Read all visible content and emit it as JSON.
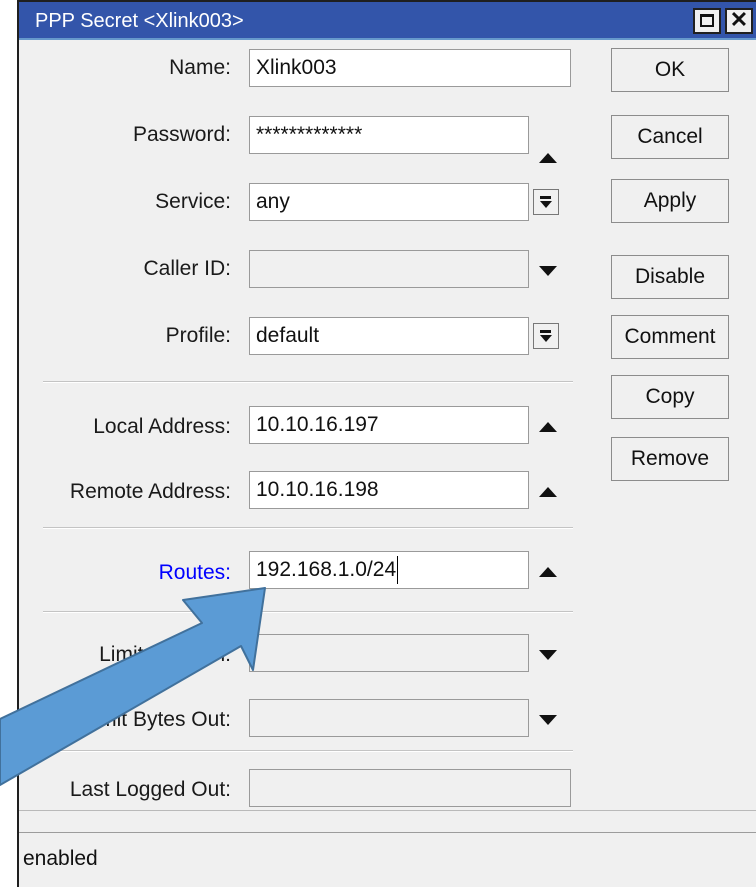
{
  "window": {
    "title": "PPP Secret <Xlink003>",
    "close_glyph": "✕"
  },
  "form": {
    "name": {
      "label": "Name:",
      "value": "Xlink003"
    },
    "password": {
      "label": "Password:",
      "value": "*************"
    },
    "service": {
      "label": "Service:",
      "value": "any"
    },
    "caller_id": {
      "label": "Caller ID:",
      "value": ""
    },
    "profile": {
      "label": "Profile:",
      "value": "default"
    },
    "local_address": {
      "label": "Local Address:",
      "value": "10.10.16.197"
    },
    "remote_address": {
      "label": "Remote Address:",
      "value": "10.10.16.198"
    },
    "routes": {
      "label": "Routes:",
      "value": "192.168.1.0/24"
    },
    "limit_bytes_in": {
      "label": "Limit Bytes In:",
      "value": ""
    },
    "limit_bytes_out": {
      "label": "Limit Bytes Out:",
      "value": ""
    },
    "last_logged_out": {
      "label": "Last Logged Out:",
      "value": ""
    }
  },
  "buttons": {
    "ok": "OK",
    "cancel": "Cancel",
    "apply": "Apply",
    "disable": "Disable",
    "comment": "Comment",
    "copy": "Copy",
    "remove": "Remove"
  },
  "status": {
    "text": "enabled"
  },
  "colors": {
    "titlebar": "#3355aa",
    "routes_label": "#0000ff",
    "callout_arrow": "#5b9bd5"
  },
  "icons": {
    "maximize": "maximize-icon",
    "close": "close-icon",
    "expand_up": "arrow-up-icon",
    "expand_down": "arrow-down-icon",
    "dropdown": "dropdown-icon",
    "callout": "callout-arrow-icon"
  }
}
